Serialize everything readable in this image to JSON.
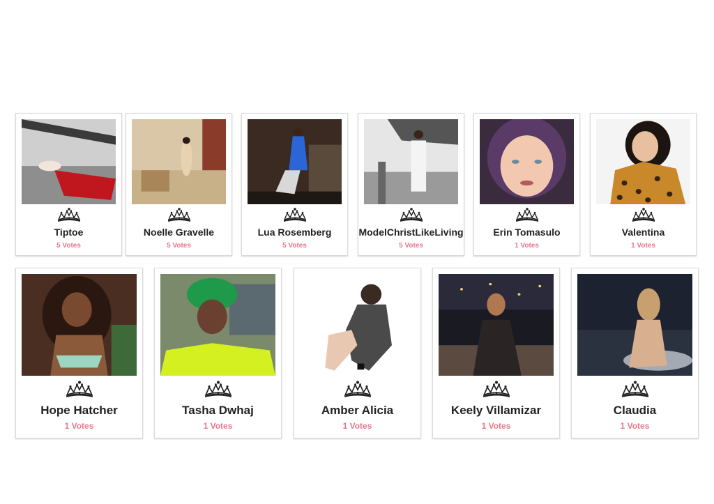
{
  "contestants_row1": [
    {
      "name": "Tiptoe",
      "votes": "5 Votes"
    },
    {
      "name": "Noelle Gravelle",
      "votes": "5 Votes"
    },
    {
      "name": "Lua Rosemberg",
      "votes": "5 Votes"
    },
    {
      "name": "ModelChristLikeLiving",
      "votes": "5 Votes"
    },
    {
      "name": "Erin Tomasulo",
      "votes": "1 Votes"
    },
    {
      "name": "Valentina",
      "votes": "1 Votes"
    }
  ],
  "contestants_row2": [
    {
      "name": "Hope Hatcher",
      "votes": "1 Votes"
    },
    {
      "name": "Tasha Dwhaj",
      "votes": "1 Votes"
    },
    {
      "name": "Amber Alicia",
      "votes": "1 Votes"
    },
    {
      "name": "Keely Villamizar",
      "votes": "1 Votes"
    },
    {
      "name": "Claudia",
      "votes": "1 Votes"
    }
  ],
  "icons": {
    "rank": "tiara-icon"
  },
  "colors": {
    "votes": "#e8778d",
    "name": "#222222",
    "card_border": "#dadada"
  }
}
